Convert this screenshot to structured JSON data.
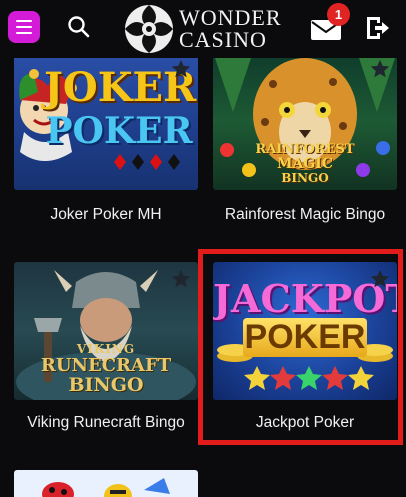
{
  "header": {
    "logo_line1": "WONDER",
    "logo_line2": "CASINO",
    "notification_count": "1",
    "icons": [
      "menu-icon",
      "search-icon",
      "mail-icon",
      "logout-icon"
    ],
    "menu_color": "#d41bd8",
    "badge_color": "#e02424"
  },
  "games": [
    {
      "caption": "Joker Poker MH",
      "art_line1": "JOKER",
      "art_line2": "POKER"
    },
    {
      "caption": "Rainforest Magic Bingo",
      "art_line1": "RAINFOREST",
      "art_line2": "MAGIC",
      "art_line3": "BINGO"
    },
    {
      "caption": "Viking Runecraft Bingo",
      "art_line1": "VIKING",
      "art_line2": "RUNECRAFT",
      "art_line3": "BINGO"
    },
    {
      "caption": "Jackpot Poker",
      "art_line1": "JACKPOT",
      "art_line2": "POKER",
      "selected": true
    }
  ],
  "highlight_color": "#e21b1b"
}
